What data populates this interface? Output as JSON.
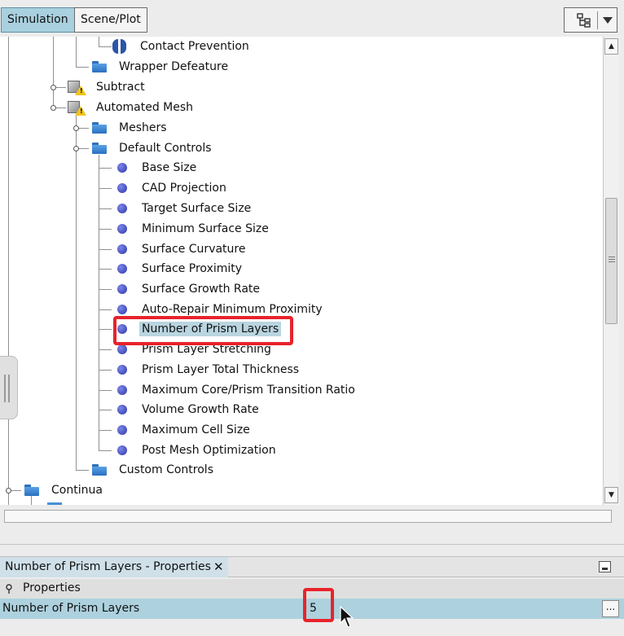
{
  "tabs": {
    "simulation": "Simulation",
    "scene_plot": "Scene/Plot"
  },
  "tree": {
    "items": [
      {
        "label": "Contact Prevention",
        "icon": "contact-prevention-icon"
      },
      {
        "label": "Wrapper Defeature",
        "icon": "folder-icon"
      },
      {
        "label": "Subtract",
        "icon": "mesh-warning-icon"
      },
      {
        "label": "Automated Mesh",
        "icon": "mesh-warning-icon"
      },
      {
        "label": "Meshers",
        "icon": "folder-icon"
      },
      {
        "label": "Default Controls",
        "icon": "folder-icon"
      },
      {
        "label": "Base Size",
        "icon": "node-dot-icon"
      },
      {
        "label": "CAD Projection",
        "icon": "node-dot-icon"
      },
      {
        "label": "Target Surface Size",
        "icon": "node-dot-icon"
      },
      {
        "label": "Minimum Surface Size",
        "icon": "node-dot-icon"
      },
      {
        "label": "Surface Curvature",
        "icon": "node-dot-icon"
      },
      {
        "label": "Surface Proximity",
        "icon": "node-dot-icon"
      },
      {
        "label": "Surface Growth Rate",
        "icon": "node-dot-icon"
      },
      {
        "label": "Auto-Repair Minimum Proximity",
        "icon": "node-dot-icon"
      },
      {
        "label": "Number of Prism Layers",
        "icon": "node-dot-icon",
        "selected": true
      },
      {
        "label": "Prism Layer Stretching",
        "icon": "node-dot-icon"
      },
      {
        "label": "Prism Layer Total Thickness",
        "icon": "node-dot-icon"
      },
      {
        "label": "Maximum Core/Prism Transition Ratio",
        "icon": "node-dot-icon"
      },
      {
        "label": "Volume Growth Rate",
        "icon": "node-dot-icon"
      },
      {
        "label": "Maximum Cell Size",
        "icon": "node-dot-icon"
      },
      {
        "label": "Post Mesh Optimization",
        "icon": "node-dot-icon"
      },
      {
        "label": "Custom Controls",
        "icon": "folder-icon"
      },
      {
        "label": "Continua",
        "icon": "folder-icon"
      }
    ]
  },
  "properties_panel": {
    "tab_title": "Number of Prism Layers - Properties",
    "close_glyph": "✕",
    "section_label": "Properties",
    "property_name": "Number of Prism Layers",
    "property_value": "5",
    "ellipsis_label": "..."
  },
  "colors": {
    "highlight": "#e8232b",
    "selection": "#b9d5e0",
    "active_tab": "#a9d0df"
  }
}
